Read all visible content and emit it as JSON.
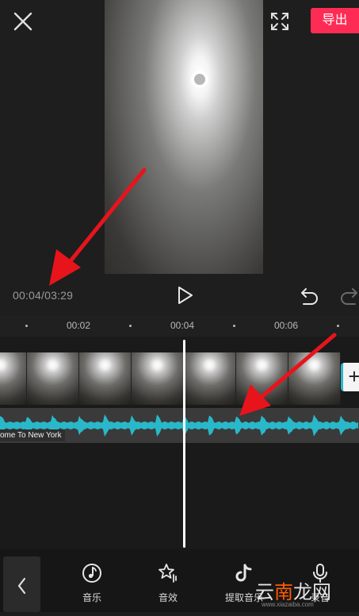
{
  "header": {
    "export_label": "导出"
  },
  "player": {
    "timecode": "00:04/03:29"
  },
  "ruler": {
    "ticks": [
      "00:02",
      "00:04",
      "00:06"
    ]
  },
  "audio": {
    "clip_label": "ome To New York"
  },
  "toolbar": {
    "items": [
      {
        "label": "音乐",
        "icon": "music-icon"
      },
      {
        "label": "音效",
        "icon": "sound-effect-icon"
      },
      {
        "label": "提取音乐",
        "icon": "tiktok-icon"
      },
      {
        "label": "录音",
        "icon": "microphone-icon"
      }
    ]
  },
  "watermark": {
    "brand_part1": "云",
    "brand_part2": "南",
    "brand_part3": "龙网",
    "url": "www.xiazaiba.com"
  },
  "colors": {
    "accent": "#fe2c55",
    "audio_wave": "#29b8c9",
    "annotation_arrow": "#e8141b",
    "background": "#1e1e1e"
  }
}
